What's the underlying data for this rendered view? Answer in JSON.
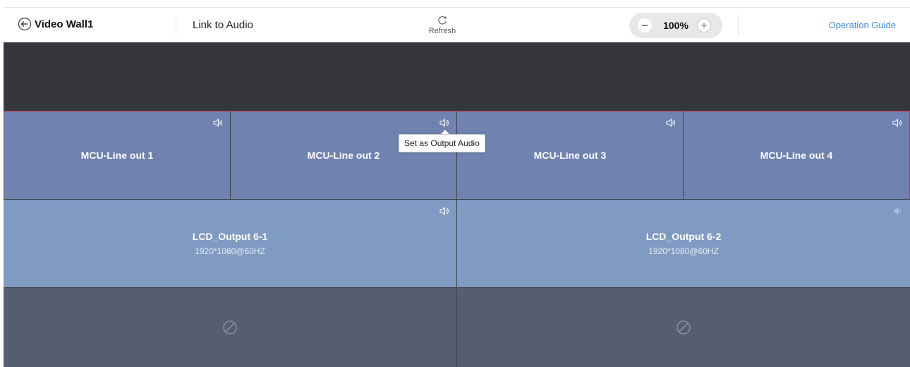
{
  "header": {
    "wall_title": "Video Wall1",
    "link_audio": "Link to Audio",
    "refresh": "Refresh",
    "zoom": "100%",
    "operation_guide": "Operation Guide"
  },
  "mcu_outputs": [
    {
      "name": "MCU-Line out 1"
    },
    {
      "name": "MCU-Line out 2"
    },
    {
      "name": "MCU-Line out 3"
    },
    {
      "name": "MCU-Line out 4"
    }
  ],
  "lcd_outputs": [
    {
      "name": "LCD_Output 6-1",
      "resolution": "1920*1080@60HZ"
    },
    {
      "name": "LCD_Output 6-2",
      "resolution": "1920*1080@60HZ"
    }
  ],
  "tooltip": "Set as Output Audio",
  "icons": {
    "back": "back-arrow-circle-icon",
    "refresh": "refresh-icon",
    "zoom_out": "minus-icon",
    "zoom_in": "plus-icon",
    "speaker": "speaker-icon",
    "empty": "no-signal-icon"
  },
  "colors": {
    "mcu_cell": "#6f82b0",
    "lcd_cell": "#7f9bc2",
    "empty_cell": "#545e6f",
    "canvas": "#36373c",
    "selection_border": "#c53a3a",
    "link": "#3d8de3"
  }
}
